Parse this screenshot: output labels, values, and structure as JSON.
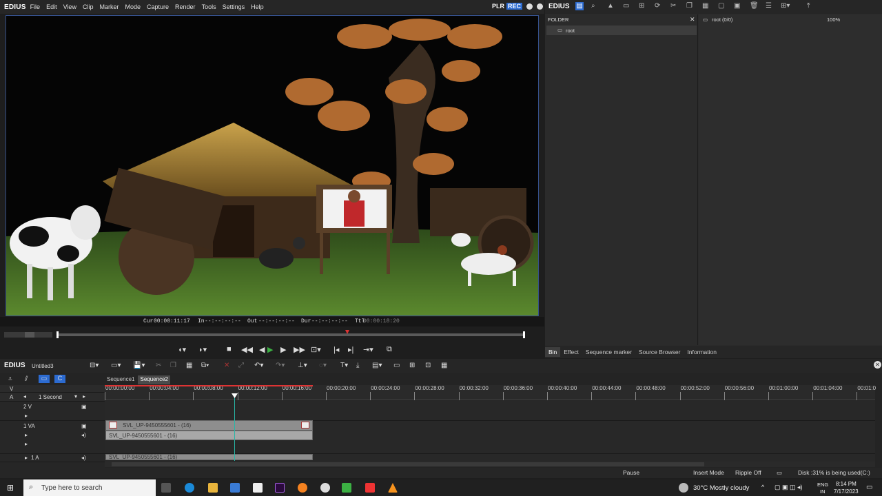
{
  "app": {
    "logo": "EDIUS",
    "plr": "PLR",
    "rec": "REC"
  },
  "menu": [
    "File",
    "Edit",
    "View",
    "Clip",
    "Marker",
    "Mode",
    "Capture",
    "Render",
    "Tools",
    "Settings",
    "Help"
  ],
  "timecode": {
    "cur_label": "Cur",
    "cur": "00:00:11:17",
    "in_label": "In",
    "in": "--:--:--:--",
    "out_label": "Out",
    "out": "--:--:--:--",
    "dur_label": "Dur",
    "dur": "--:--:--:--",
    "ttl_label": "Ttl",
    "ttl": "00:00:18:20"
  },
  "right_panel": {
    "logo": "EDIUS",
    "folder_header": "FOLDER",
    "folder_root": "root",
    "bin_path": "root (0/0)",
    "zoom": "100%",
    "tabs": [
      "Bin",
      "Effect",
      "Sequence marker",
      "Source Browser",
      "Information"
    ]
  },
  "timeline": {
    "logo": "EDIUS",
    "project": "Untitled3",
    "sequences": [
      "Sequence1",
      "Sequence2"
    ],
    "scale": "1 Second",
    "ruler": [
      "00:00:00:00",
      "00:00:04:00",
      "00:00:08:00",
      "00:00:12:00",
      "00:00:16:00",
      "00:00:20:00",
      "00:00:24:00",
      "00:00:28:00",
      "00:00:32:00",
      "00:00:36:00",
      "00:00:40:00",
      "00:00:44:00",
      "00:00:48:00",
      "00:00:52:00",
      "00:00:56:00",
      "00:01:00:00",
      "00:01:04:00",
      "00:01:0"
    ],
    "tracks": {
      "v": "V",
      "a": "A",
      "t2v": "2 V",
      "t1va": "1 VA",
      "t1a": "1 A"
    },
    "clip_video": "SVL_UP-9450555601 - (16)",
    "clip_audio": "SVL_UP-9450555601 - (16)",
    "clip_audio2": "SVL_UP-9450555601 - (16)"
  },
  "status": {
    "pause": "Pause",
    "insert": "Insert Mode",
    "ripple": "Ripple Off",
    "disk": "Disk :31% is being used(C:)"
  },
  "taskbar": {
    "search_placeholder": "Type here to search",
    "weather": "30°C  Mostly cloudy",
    "lang1": "ENG",
    "lang2": "IN",
    "time": "8:14 PM",
    "date": "7/17/2023"
  }
}
